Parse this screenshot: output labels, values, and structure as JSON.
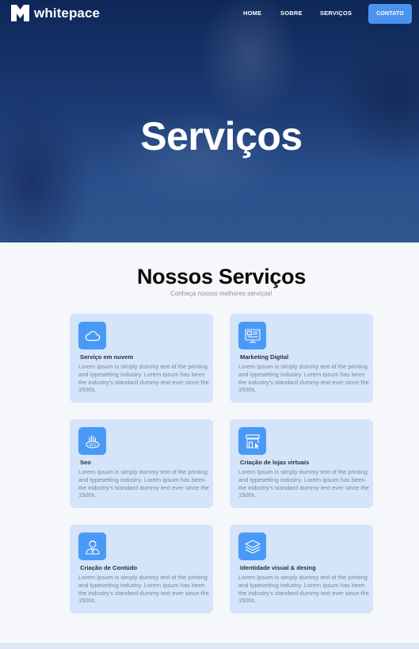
{
  "nav": {
    "brand": "whitepace",
    "links": [
      "HOME",
      "SOBRE",
      "SERVIÇOS"
    ],
    "cta": "CONTATO"
  },
  "hero": {
    "title": "Serviços"
  },
  "section": {
    "title": "Nossos Serviços",
    "subtitle": "Conheça nossos melhores serviços!"
  },
  "services": [
    {
      "title": "Serviço em nuvem",
      "icon": "cloud-icon",
      "text": "Lorem Ipsum is simply dummy text of the printing and typesetting industry. Lorem Ipsum has been the industry's standard dummy text ever since the 1500s."
    },
    {
      "title": "Marketing Digital",
      "icon": "marketing-icon",
      "text": "Lorem Ipsum is simply dummy text of the printing and typesetting industry. Lorem Ipsum has been the industry's standard dummy text ever since the 1500s."
    },
    {
      "title": "Seo",
      "icon": "seo-icon",
      "text": "Lorem Ipsum is simply dummy text of the printing and typesetting industry. Lorem Ipsum has been the industry's standard dummy text ever since the 1500s."
    },
    {
      "title": "Criação de lojas virtuais",
      "icon": "store-icon",
      "text": "Lorem Ipsum is simply dummy text of the printing and typesetting industry. Lorem Ipsum has been the industry's standard dummy text ever since the 1500s."
    },
    {
      "title": "Criação de Contúdo",
      "icon": "content-creator-icon",
      "text": "Lorem Ipsum is simply dummy text of the printing and typesetting industry. Lorem Ipsum has been the industry's standard dummy text ever since the 1500s."
    },
    {
      "title": "Identidade visual & desing",
      "icon": "layers-icon",
      "text": "Lorem Ipsum is simply dummy text of the printing and typesetting industry. Lorem Ipsum has been the industry's standard dummy text ever since the 1500s."
    }
  ],
  "colors": {
    "accent": "#4a94f0",
    "card_bg": "#d3e4fb",
    "hero_dark": "#0f2a5a"
  }
}
